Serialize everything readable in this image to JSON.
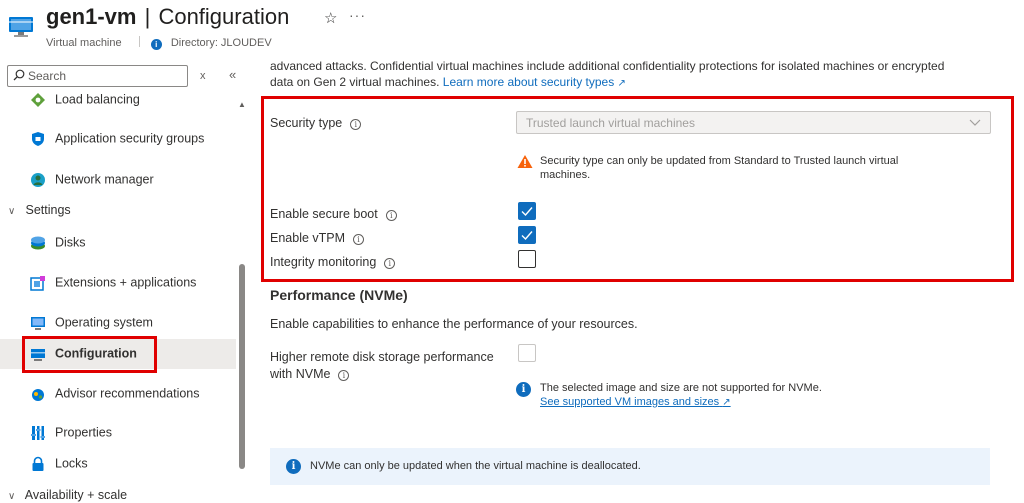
{
  "header": {
    "resource_name": "gen1-vm",
    "separator": "|",
    "blade_name": "Configuration",
    "star_icon": "star-icon",
    "more_label": "···",
    "resource_type": "Virtual machine",
    "directory": "Directory: JLOUDEV"
  },
  "sidebar": {
    "search_placeholder": "Search",
    "clear_label": "x",
    "collapse_label": "«",
    "items": [
      {
        "label": "Load balancing",
        "icon": "load-balancing-icon"
      },
      {
        "label": "Application security groups",
        "icon": "app-security-groups-icon"
      },
      {
        "label": "Network manager",
        "icon": "network-manager-icon"
      },
      {
        "label": "Disks",
        "icon": "disks-icon"
      },
      {
        "label": "Extensions + applications",
        "icon": "extensions-icon"
      },
      {
        "label": "Operating system",
        "icon": "operating-system-icon"
      },
      {
        "label": "Configuration",
        "icon": "configuration-icon",
        "selected": true
      },
      {
        "label": "Advisor recommendations",
        "icon": "advisor-icon"
      },
      {
        "label": "Properties",
        "icon": "properties-icon"
      },
      {
        "label": "Locks",
        "icon": "locks-icon"
      }
    ],
    "groups": {
      "settings": "Settings",
      "availability": "Availability + scale"
    }
  },
  "main": {
    "intro_text": "advanced attacks. Confidential virtual machines include additional confidentiality protections for isolated machines or encrypted data on Gen 2 virtual machines.",
    "intro_link": "Learn more about security types",
    "security_type": {
      "label": "Security type",
      "value": "Trusted launch virtual machines",
      "warning": "Security type can only be updated from Standard to Trusted launch virtual machines."
    },
    "secure_boot": {
      "label": "Enable secure boot",
      "checked": true
    },
    "vtpm": {
      "label": "Enable vTPM",
      "checked": true
    },
    "integrity": {
      "label": "Integrity monitoring",
      "checked": false
    },
    "performance": {
      "title": "Performance (NVMe)",
      "description": "Enable capabilities to enhance the performance of your resources.",
      "nvme_label": "Higher remote disk storage performance with NVMe",
      "nvme_checked": false,
      "note": "The selected image and size are not supported for NVMe.",
      "note_link": "See supported VM images and sizes"
    },
    "banner": "NVMe can only be updated when the virtual machine is deallocated."
  },
  "colors": {
    "accent": "#0f6cbd",
    "highlight_border": "#e00000",
    "warning": "#f7630c"
  }
}
